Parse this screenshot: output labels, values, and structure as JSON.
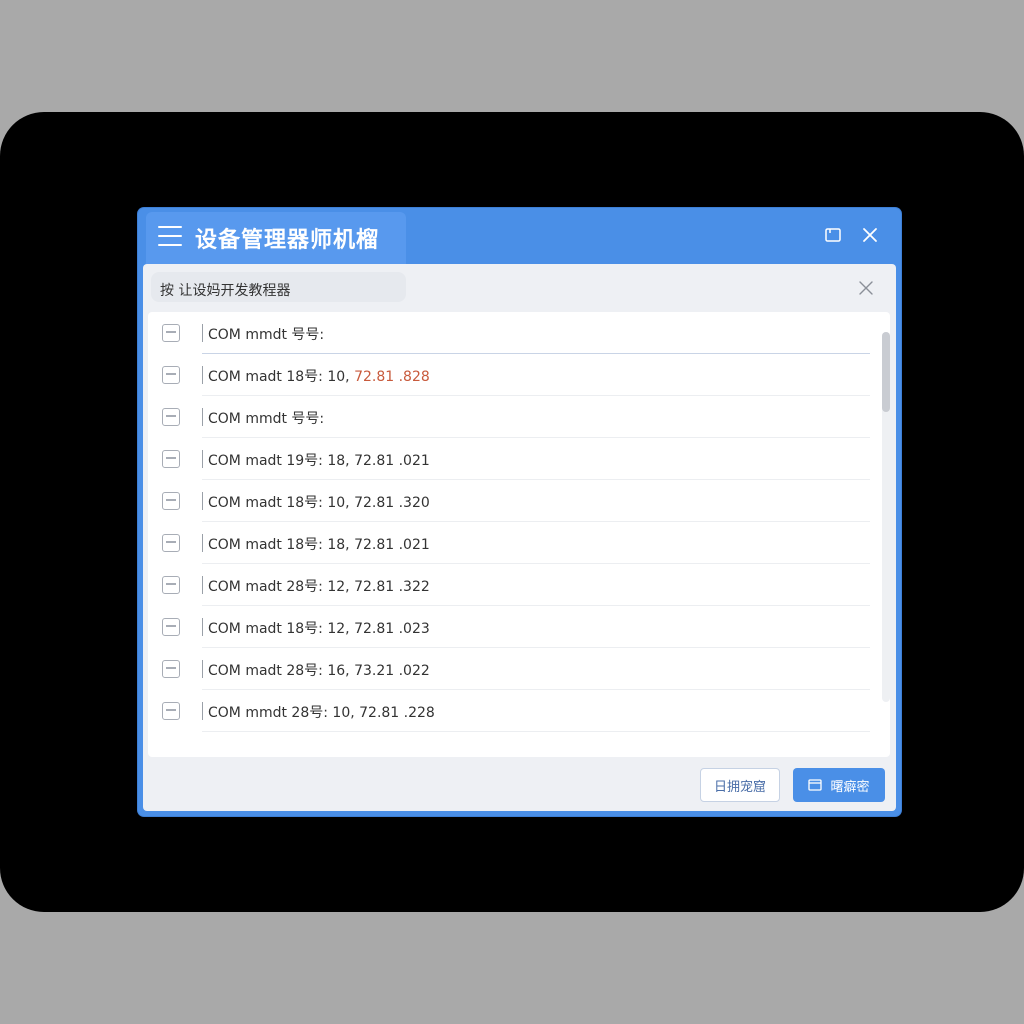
{
  "window": {
    "title": "设备管理器师机榴"
  },
  "panel": {
    "header_text": "按 让设妈开发教程器"
  },
  "devices": [
    {
      "label": "COM mmdt 号号:",
      "ip": "",
      "icon": "clipboard-icon",
      "active": true
    },
    {
      "label": "COM madt 18号: 10,",
      "ip": "72.81 .828",
      "icon": "filter-icon",
      "ip_color": "#c85a3c"
    },
    {
      "label": "COM mmdt 号号:",
      "ip": "",
      "icon": "list-icon"
    },
    {
      "label": "COM madt 19号: 18,",
      "ip": "72.81 .021",
      "icon": "briefcase-icon"
    },
    {
      "label": "COM madt 18号: 10,",
      "ip": "72.81 .320",
      "icon": "list-icon"
    },
    {
      "label": "COM madt 18号: 18,",
      "ip": "72.81 .021",
      "icon": "plug-icon"
    },
    {
      "label": "COM madt 28号: 12,",
      "ip": "72.81 .322",
      "icon": "mail-icon"
    },
    {
      "label": "COM madt 18号: 12,",
      "ip": "72.81 .023",
      "icon": "list-icon"
    },
    {
      "label": "COM madt 28号: 16,",
      "ip": "73.21 .022",
      "icon": "minus-box-icon"
    },
    {
      "label": "COM mmdt 28号: 10,",
      "ip": "72.81 .228",
      "icon": "drive-icon"
    }
  ],
  "buttons": {
    "secondary_label": "日拥宠窟",
    "primary_label": "曙癖密"
  },
  "colors": {
    "accent": "#4a8fe7",
    "highlight_ip": "#c85a3c"
  }
}
